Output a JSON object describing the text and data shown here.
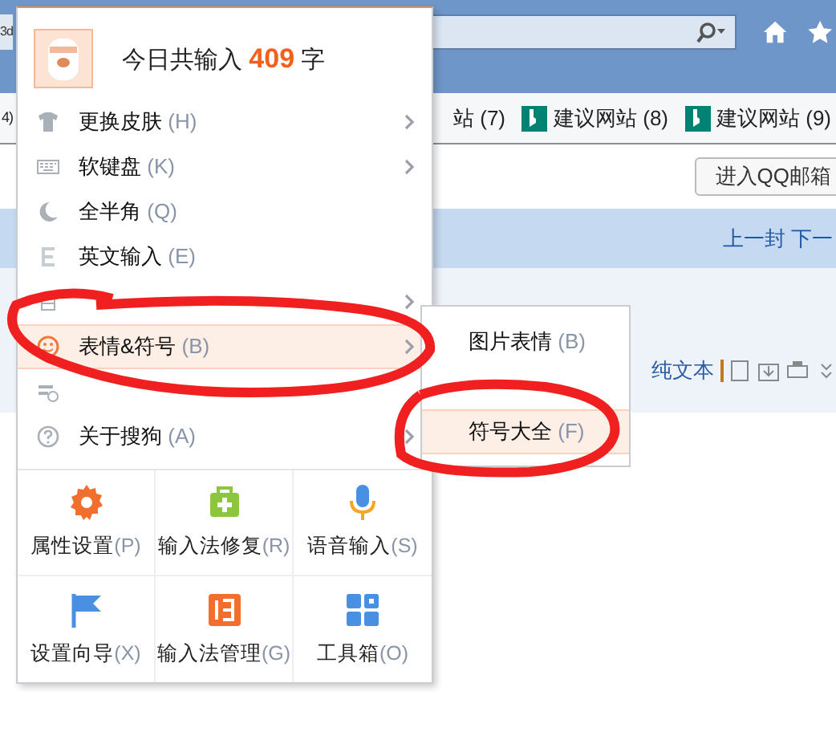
{
  "browser": {
    "tab_fragment": "3d",
    "bookmarks": [
      {
        "label": "站 (7)",
        "logo": false
      },
      {
        "label": "建议网站 (8)",
        "logo": true
      },
      {
        "label": "建议网站 (9)",
        "logo": true
      }
    ],
    "row_fragment": "4)",
    "mail_button": "进入QQ邮箱",
    "nav_links": "上一封 下一",
    "plain_text": "纯文本"
  },
  "menu": {
    "header": {
      "prefix": "今日共输入",
      "count": "409",
      "suffix": "字"
    },
    "items": [
      {
        "label": "更换皮肤",
        "shortcut": "(H)",
        "has_submenu": true,
        "selected": false
      },
      {
        "label": "软键盘",
        "shortcut": "(K)",
        "has_submenu": true,
        "selected": false
      },
      {
        "label": "全半角",
        "shortcut": "(Q)",
        "has_submenu": false,
        "selected": false
      },
      {
        "label": "英文输入",
        "shortcut": "(E)",
        "has_submenu": false,
        "selected": false
      },
      {
        "has_submenu": true,
        "selected": false
      },
      {
        "label": "表情&符号",
        "shortcut": "(B)",
        "has_submenu": true,
        "selected": true
      },
      {
        "has_submenu": false,
        "selected": false
      },
      {
        "label": "关于搜狗",
        "shortcut": "(A)",
        "has_submenu": true,
        "selected": false
      }
    ],
    "tools": [
      {
        "label": "属性设置",
        "shortcut": "(P)"
      },
      {
        "label": "输入法修复",
        "shortcut": "(R)"
      },
      {
        "label": "语音输入",
        "shortcut": "(S)"
      },
      {
        "label": "设置向导",
        "shortcut": "(X)"
      },
      {
        "label": "输入法管理",
        "shortcut": "(G)"
      },
      {
        "label": "工具箱",
        "shortcut": "(O)"
      }
    ]
  },
  "submenu": {
    "items": [
      {
        "label": "图片表情",
        "shortcut": "(B)",
        "selected": false
      },
      {
        "selected": false
      },
      {
        "label": "符号大全",
        "shortcut": "(F)",
        "selected": true
      }
    ]
  }
}
